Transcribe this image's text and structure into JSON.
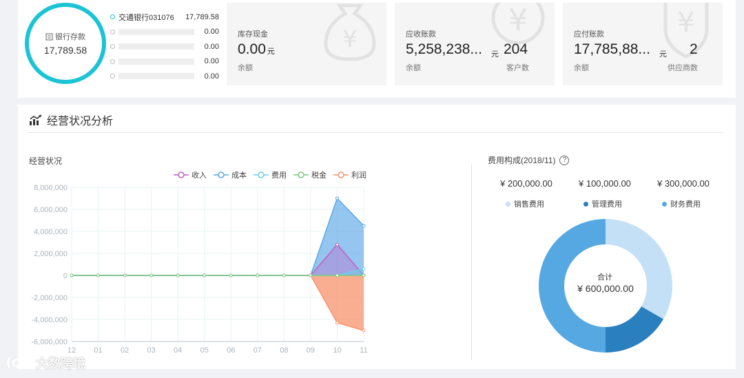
{
  "deposit": {
    "label": "银行存款",
    "value": "17,789.58"
  },
  "banks": [
    {
      "name": "交通银行031076",
      "amount": "17,789.58",
      "active": true
    },
    {
      "name": "",
      "amount": "0.00",
      "active": false
    },
    {
      "name": "",
      "amount": "0.00",
      "active": false
    },
    {
      "name": "",
      "amount": "0.00",
      "active": false
    },
    {
      "name": "",
      "amount": "0.00",
      "active": false
    }
  ],
  "cards": {
    "cash": {
      "title": "库存现金",
      "value": "0.00",
      "unit": "元",
      "sub": "余额"
    },
    "receivable": {
      "title": "应收账款",
      "value": "5,258,238...",
      "unit": "元",
      "sub": "余额",
      "count": "204",
      "count_label": "客户数"
    },
    "payable": {
      "title": "应付账款",
      "value": "17,785,88...",
      "unit": "元",
      "sub": "余额",
      "count": "2",
      "count_label": "供应商数"
    }
  },
  "section": {
    "title": "经营状况分析"
  },
  "colors": {
    "accent": "#1bc4d4",
    "income": "#c25fc2",
    "cost": "#5aa8e8",
    "expense": "#6ad1ea",
    "tax": "#7cc97c",
    "profit": "#f7936c"
  },
  "chart_data": [
    {
      "type": "area",
      "title": "经营状况",
      "categories": [
        "12",
        "01",
        "02",
        "03",
        "04",
        "05",
        "06",
        "07",
        "08",
        "09",
        "10",
        "11"
      ],
      "ylim": [
        -6000000,
        8000000
      ],
      "yticks": [
        "8,000,000",
        "6,000,000",
        "4,000,000",
        "2,000,000",
        "0",
        "-2,000,000",
        "-4,000,000",
        "-6,000,000"
      ],
      "ytick_values": [
        8000000,
        6000000,
        4000000,
        2000000,
        0,
        -2000000,
        -4000000,
        -6000000
      ],
      "grid": true,
      "legend_position": "top",
      "series": [
        {
          "name": "收入",
          "values": [
            0,
            0,
            0,
            0,
            0,
            0,
            0,
            0,
            0,
            0,
            2800000,
            0
          ]
        },
        {
          "name": "成本",
          "values": [
            0,
            0,
            0,
            0,
            0,
            0,
            0,
            0,
            0,
            0,
            7000000,
            4500000
          ]
        },
        {
          "name": "费用",
          "values": [
            0,
            0,
            0,
            0,
            0,
            0,
            0,
            0,
            0,
            0,
            0,
            600000
          ]
        },
        {
          "name": "税金",
          "values": [
            0,
            0,
            0,
            0,
            0,
            0,
            0,
            0,
            0,
            0,
            0,
            0
          ]
        },
        {
          "name": "利润",
          "values": [
            0,
            0,
            0,
            0,
            0,
            0,
            0,
            0,
            0,
            0,
            -4300000,
            -5000000
          ]
        }
      ]
    },
    {
      "type": "pie",
      "title": "费用构成(2018/11)",
      "center_label": "合计",
      "center_value": "¥ 600,000.00",
      "categories": [
        "销售费用",
        "管理费用",
        "财务费用"
      ],
      "values": [
        200000,
        100000,
        300000
      ],
      "value_labels": [
        "¥ 200,000.00",
        "¥ 100,000.00",
        "¥ 300,000.00"
      ],
      "colors": [
        "#c4e0f7",
        "#2a7fbf",
        "#56a8e2"
      ]
    }
  ],
  "watermark": "大数跨境"
}
